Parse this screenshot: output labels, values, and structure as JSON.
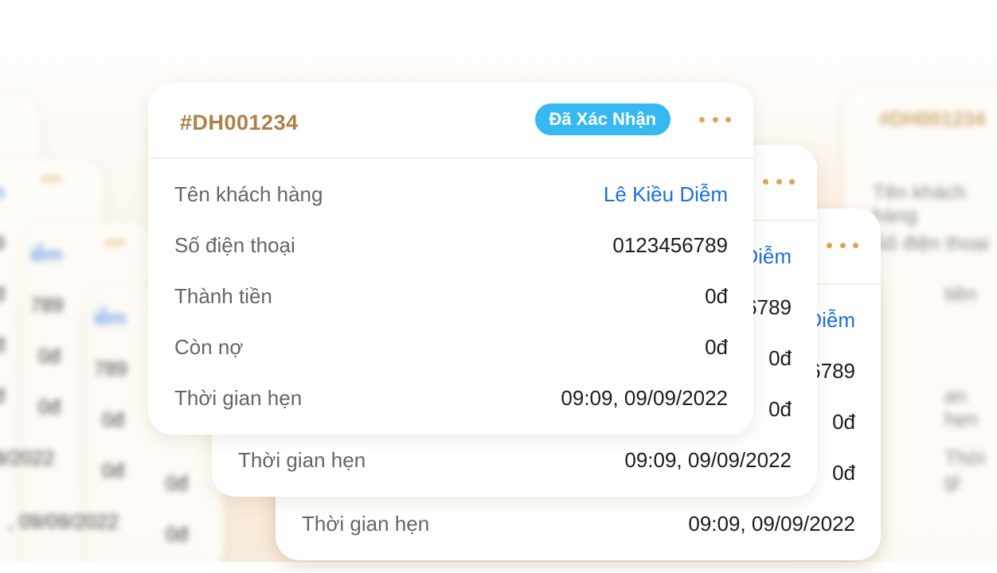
{
  "order": {
    "code": "#DH001234",
    "status": "Đã Xác Nhận",
    "rows": [
      {
        "label": "Tên khách hàng",
        "value": "Lê Kiều Diễm"
      },
      {
        "label": "Số điện thoại",
        "value": "0123456789"
      },
      {
        "label": "Thành tiền",
        "value": "0đ"
      },
      {
        "label": "Còn nợ",
        "value": "0đ"
      },
      {
        "label": "Thời gian hẹn",
        "value": "09:09, 09/09/2022"
      }
    ]
  },
  "colors": {
    "order_code": "#ad8047",
    "badge": "#36b9f1",
    "more_dots": "#d9a75c",
    "customer_link": "#1a6fe3"
  },
  "icons": {
    "more": "more-horizontal-icon"
  }
}
